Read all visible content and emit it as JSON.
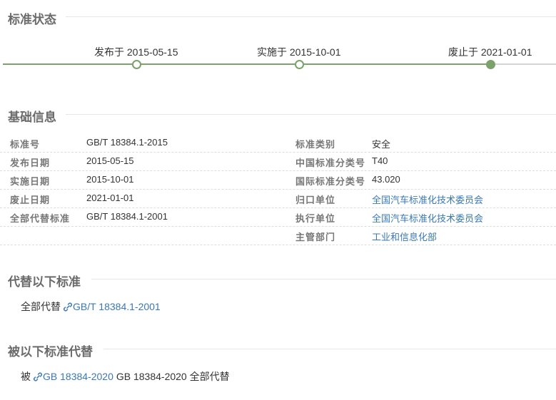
{
  "status": {
    "title": "标准状态",
    "timeline": [
      {
        "label": "发布于 2015-05-15",
        "filled": false
      },
      {
        "label": "实施于 2015-10-01",
        "filled": false
      },
      {
        "label": "废止于 2021-01-01",
        "filled": true
      }
    ]
  },
  "basic": {
    "title": "基础信息",
    "rows": [
      {
        "k1": "标准号",
        "v1": "GB/T 18384.1-2015",
        "k2": "标准类别",
        "v2": "安全"
      },
      {
        "k1": "发布日期",
        "v1": "2015-05-15",
        "k2": "中国标准分类号",
        "v2": "T40"
      },
      {
        "k1": "实施日期",
        "v1": "2015-10-01",
        "k2": "国际标准分类号",
        "v2": "43.020"
      },
      {
        "k1": "废止日期",
        "v1": "2021-01-01",
        "k2": "归口单位",
        "v2": "全国汽车标准化技术委员会"
      },
      {
        "k1": "全部代替标准",
        "v1": "GB/T 18384.1-2001",
        "k2": "执行单位",
        "v2": "全国汽车标准化技术委员会"
      },
      {
        "k1": "",
        "v1": "",
        "k2": "主管部门",
        "v2": "工业和信息化部"
      }
    ]
  },
  "replaces": {
    "title": "代替以下标准",
    "prefix": "全部代替",
    "link": "GB/T 18384.1-2001"
  },
  "replaced_by": {
    "title": "被以下标准代替",
    "prefix": "被",
    "link": "GB 18384-2020",
    "suffix": "GB 18384-2020 全部代替"
  },
  "colors": {
    "accent": "#7aa26a",
    "link": "#3a78b5",
    "heading": "#6b6b6b"
  },
  "icons": [
    "link-icon"
  ]
}
